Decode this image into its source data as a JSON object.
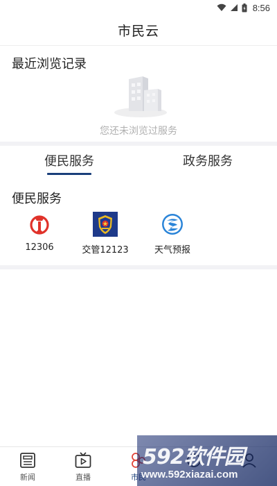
{
  "status_bar": {
    "time": "8:56",
    "icons": [
      "wifi-icon",
      "signal-icon",
      "battery-icon"
    ]
  },
  "header": {
    "title": "市民云"
  },
  "recent": {
    "heading": "最近浏览记录",
    "empty_text": "您还未浏览过服务"
  },
  "tabs": [
    {
      "label": "便民服务",
      "active": true
    },
    {
      "label": "政务服务",
      "active": false
    }
  ],
  "services": {
    "heading": "便民服务",
    "items": [
      {
        "label": "12306",
        "icon": "railway-icon"
      },
      {
        "label": "交管12123",
        "icon": "police-emblem-icon"
      },
      {
        "label": "天气预报",
        "icon": "weather-icon"
      }
    ]
  },
  "bottom_nav": [
    {
      "label": "新闻",
      "icon": "news-icon",
      "active": false
    },
    {
      "label": "直播",
      "icon": "tv-icon",
      "active": false
    },
    {
      "label": "市民",
      "icon": "citizen-icon",
      "active": true
    },
    {
      "label": "",
      "icon": "nav-icon-4",
      "active": false
    },
    {
      "label": "",
      "icon": "nav-icon-5",
      "active": false
    }
  ],
  "watermark": {
    "brand": "592软件园",
    "url": "www.592xiazai.com"
  },
  "colors": {
    "accent": "#1a3f7a",
    "active_nav": "#e0453a",
    "divider": "#f2f2f5",
    "muted_text": "#b0b0b0"
  }
}
